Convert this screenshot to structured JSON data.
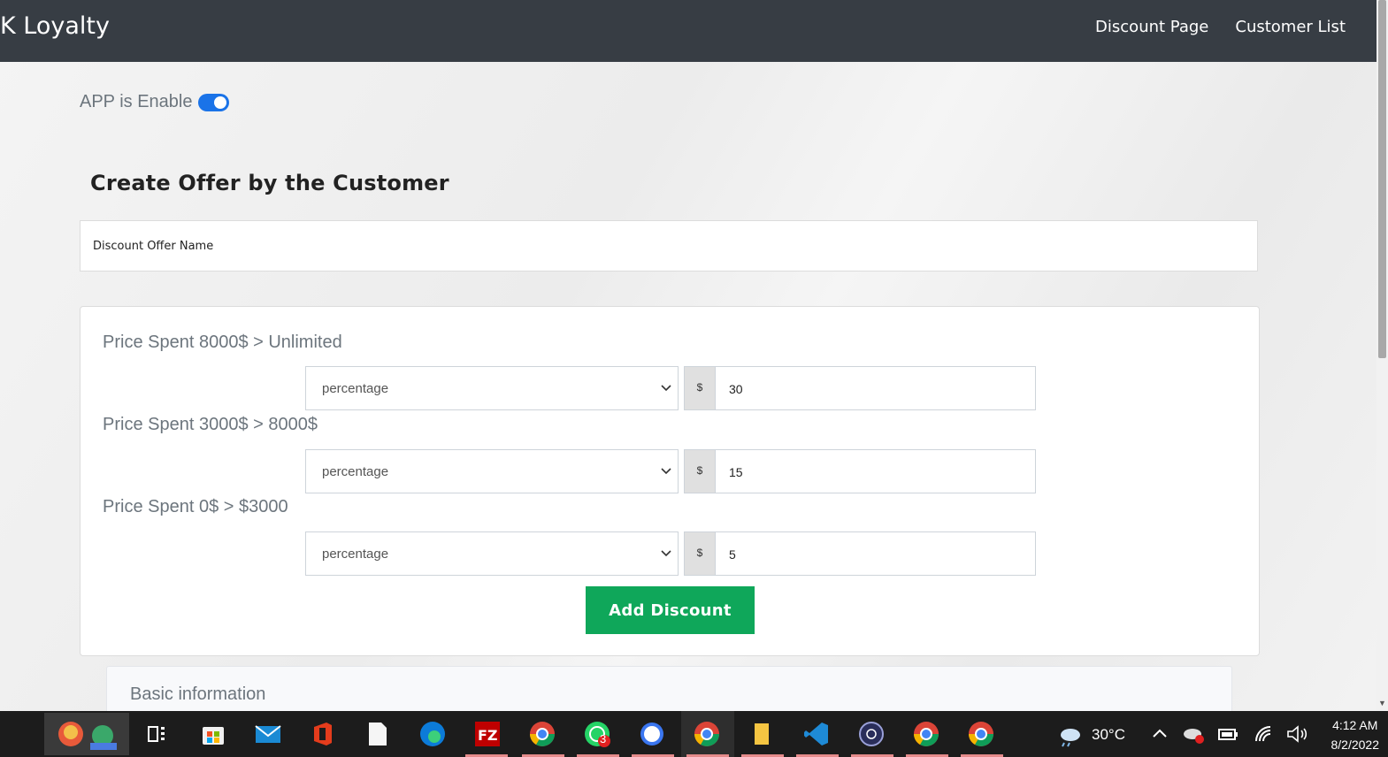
{
  "navbar": {
    "brand": "K Loyalty",
    "links": [
      "Discount Page",
      "Customer List"
    ]
  },
  "toggle": {
    "label": "APP is Enable",
    "enabled": true
  },
  "form": {
    "heading": "Create Offer by the Customer",
    "offer_name_placeholder": "Discount Offer Name"
  },
  "tiers": [
    {
      "label": "Price Spent 8000$ > Unlimited",
      "type": "percentage",
      "prefix": "$",
      "value": "30"
    },
    {
      "label": "Price Spent 3000$ > 8000$",
      "type": "percentage",
      "prefix": "$",
      "value": "15"
    },
    {
      "label": "Price Spent 0$ > $3000",
      "type": "percentage",
      "prefix": "$",
      "value": "5"
    }
  ],
  "add_button": "Add Discount",
  "basic_info": {
    "title": "Basic information"
  },
  "taskbar": {
    "weather": "30°C",
    "time": "4:12 AM",
    "date": "8/2/2022",
    "whatsapp_badge": "3",
    "apps": [
      "widgets-icon",
      "task-view-icon",
      "store-icon",
      "mail-icon",
      "office-icon",
      "notepad-icon",
      "edge-icon",
      "filezilla-icon",
      "chrome-profile-icon",
      "whatsapp-icon",
      "signal-icon",
      "chrome-active-icon",
      "file-explorer-icon",
      "vscode-icon",
      "app-circle-icon",
      "chrome-2-icon",
      "chrome-3-icon"
    ]
  },
  "colors": {
    "navbar": "#373d44",
    "accent_green": "#0fa75a",
    "toggle_blue": "#1a73e8"
  }
}
